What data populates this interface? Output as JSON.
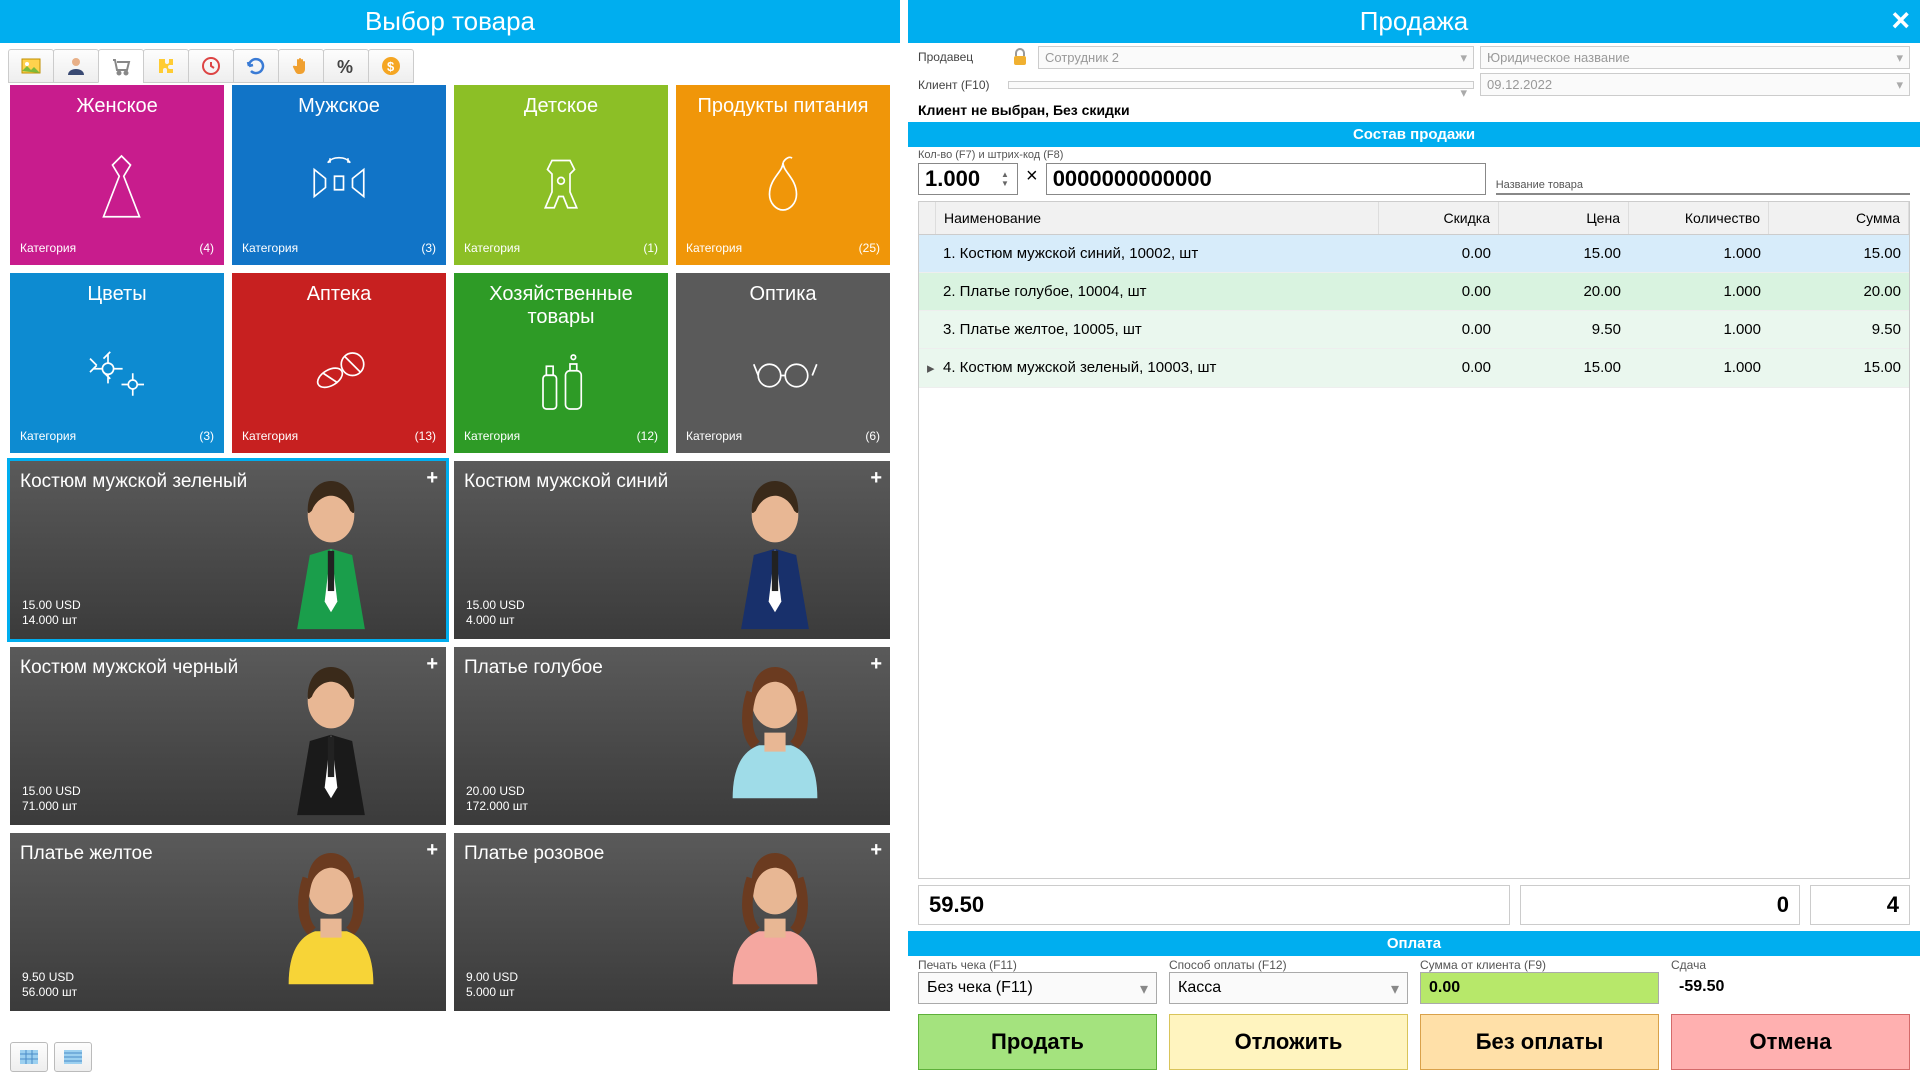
{
  "left": {
    "title": "Выбор товара",
    "categories": [
      {
        "title": "Женское",
        "label": "Категория",
        "count": "(4)",
        "color": "#c81c8d",
        "icon": "dress"
      },
      {
        "title": "Мужское",
        "label": "Категория",
        "count": "(3)",
        "color": "#1174c7",
        "icon": "bowtie"
      },
      {
        "title": "Детское",
        "label": "Категория",
        "count": "(1)",
        "color": "#8cbf26",
        "icon": "baby"
      },
      {
        "title": "Продукты питания",
        "label": "Категория",
        "count": "(25)",
        "color": "#f09609",
        "icon": "pear"
      },
      {
        "title": "Цветы",
        "label": "Категория",
        "count": "(3)",
        "color": "#0d8bd1",
        "icon": "flower"
      },
      {
        "title": "Аптека",
        "label": "Категория",
        "count": "(13)",
        "color": "#c72020",
        "icon": "pills"
      },
      {
        "title": "Хозяйственные товары",
        "label": "Категория",
        "count": "(12)",
        "color": "#2e9b26",
        "icon": "spray"
      },
      {
        "title": "Оптика",
        "label": "Категория",
        "count": "(6)",
        "color": "#5a5a5a",
        "icon": "glasses"
      }
    ],
    "products": [
      {
        "name": "Костюм мужской зеленый",
        "price": "15.00 USD",
        "stock": "14.000 шт",
        "selected": true,
        "fig": "suit-green"
      },
      {
        "name": "Костюм мужской синий",
        "price": "15.00 USD",
        "stock": "4.000 шт",
        "fig": "suit-blue"
      },
      {
        "name": "Костюм мужской черный",
        "price": "15.00 USD",
        "stock": "71.000 шт",
        "fig": "suit-black"
      },
      {
        "name": "Платье голубое",
        "price": "20.00 USD",
        "stock": "172.000 шт",
        "fig": "dress-blue"
      },
      {
        "name": "Платье желтое",
        "price": "9.50 USD",
        "stock": "56.000 шт",
        "fig": "dress-yellow"
      },
      {
        "name": "Платье розовое",
        "price": "9.00 USD",
        "stock": "5.000 шт",
        "fig": "dress-pink"
      }
    ]
  },
  "right": {
    "title": "Продажа",
    "seller_label": "Продавец",
    "seller_value": "Сотрудник 2",
    "legal_value": "Юридическое название",
    "client_label": "Клиент (F10)",
    "date_value": "09.12.2022",
    "status": "Клиент не выбран, Без скидки",
    "section1": "Состав продажи",
    "qty_label": "Кол-во (F7) и штрих-код (F8)",
    "name_label": "Название товара",
    "qty_value": "1.000",
    "barcode_value": "0000000000000",
    "columns": {
      "name": "Наименование",
      "disc": "Скидка",
      "price": "Цена",
      "qty": "Количество",
      "sum": "Сумма"
    },
    "rows": [
      {
        "name": "1. Костюм мужской синий, 10002, шт",
        "disc": "0.00",
        "price": "15.00",
        "qty": "1.000",
        "sum": "15.00"
      },
      {
        "name": "2. Платье голубое, 10004, шт",
        "disc": "0.00",
        "price": "20.00",
        "qty": "1.000",
        "sum": "20.00"
      },
      {
        "name": "3. Платье желтое, 10005, шт",
        "disc": "0.00",
        "price": "9.50",
        "qty": "1.000",
        "sum": "9.50"
      },
      {
        "name": "4. Костюм мужской зеленый, 10003, шт",
        "disc": "0.00",
        "price": "15.00",
        "qty": "1.000",
        "sum": "15.00"
      }
    ],
    "totals": {
      "sum": "59.50",
      "mid": "0",
      "count": "4"
    },
    "section2": "Оплата",
    "pay": {
      "receipt_label": "Печать чека (F11)",
      "receipt_value": "Без чека (F11)",
      "method_label": "Способ оплаты (F12)",
      "method_value": "Касса",
      "amount_label": "Сумма от клиента (F9)",
      "amount_value": "0.00",
      "change_label": "Сдача",
      "change_value": "-59.50"
    },
    "buttons": {
      "sell": "Продать",
      "hold": "Отложить",
      "nopay": "Без оплаты",
      "cancel": "Отмена"
    }
  }
}
